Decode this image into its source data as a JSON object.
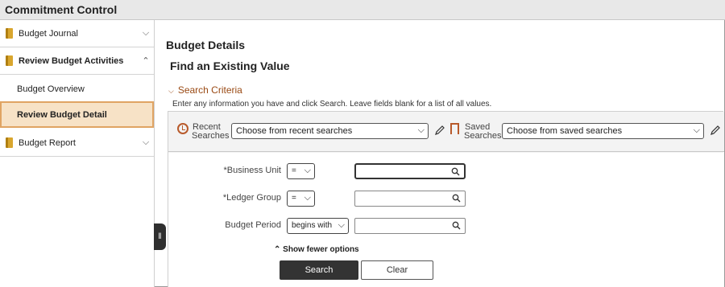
{
  "window": {
    "title": "Commitment Control"
  },
  "sidebar": {
    "items": [
      {
        "label": "Budget Journal",
        "icon": "book-icon",
        "chevron": "chevron-down-icon"
      },
      {
        "label": "Review Budget Activities",
        "icon": "book-icon",
        "chevron": "chevron-up-icon",
        "expanded": true
      },
      {
        "label": "Budget Report",
        "icon": "book-icon",
        "chevron": "chevron-down-icon"
      }
    ],
    "subitems": [
      {
        "label": "Budget Overview",
        "active": false
      },
      {
        "label": "Review Budget Detail",
        "active": true
      }
    ],
    "accent": "#f7e2c6"
  },
  "main": {
    "page_title": "Budget Details",
    "subtitle": "Find an Existing Value",
    "criteria_toggle": "Search Criteria",
    "instructions": "Enter any information you have and click Search. Leave fields blank for a list of all values.",
    "recent": {
      "label_line1": "Recent",
      "label_line2": "Searches",
      "value": "Choose from recent searches"
    },
    "saved": {
      "label_line1": "Saved",
      "label_line2": "Searches",
      "value": "Choose from saved searches"
    },
    "fields": [
      {
        "label": "*Business Unit",
        "operator": "=",
        "value": ""
      },
      {
        "label": "*Ledger Group",
        "operator": "=",
        "value": ""
      },
      {
        "label": "Budget Period",
        "operator": "begins with",
        "value": ""
      }
    ],
    "fewer_options": "Show fewer options",
    "search_button": "Search",
    "clear_button": "Clear"
  },
  "colors": {
    "accent": "#b85a2b",
    "brand_text": "#9a4a14"
  }
}
